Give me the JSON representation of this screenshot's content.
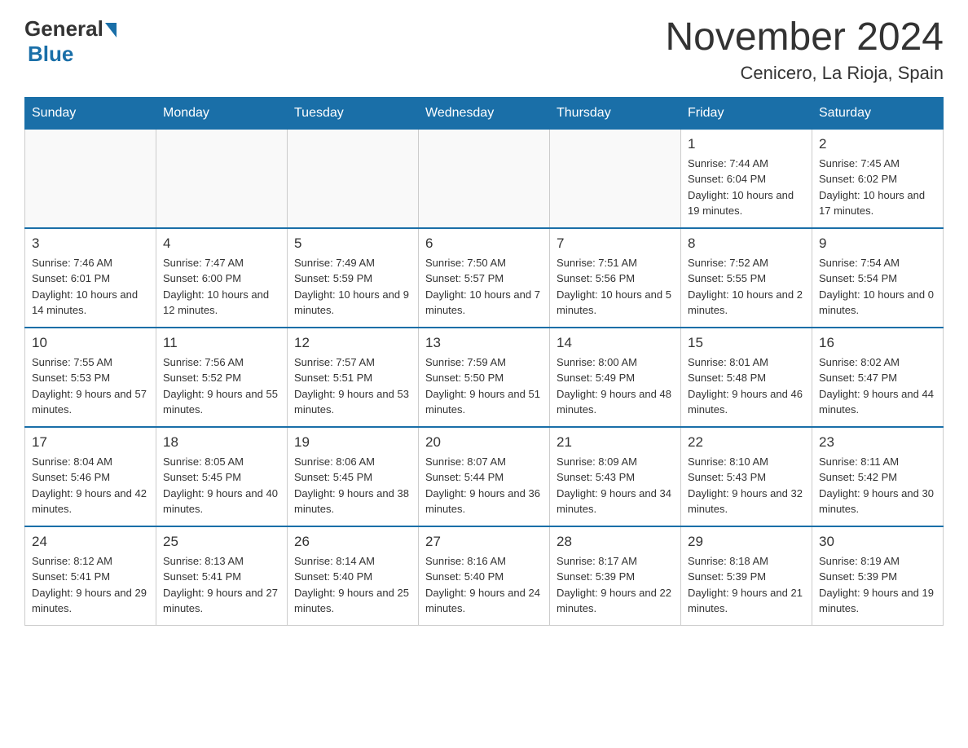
{
  "logo": {
    "general": "General",
    "blue": "Blue"
  },
  "header": {
    "month": "November 2024",
    "location": "Cenicero, La Rioja, Spain"
  },
  "weekdays": [
    "Sunday",
    "Monday",
    "Tuesday",
    "Wednesday",
    "Thursday",
    "Friday",
    "Saturday"
  ],
  "weeks": [
    [
      {
        "day": "",
        "sunrise": "",
        "sunset": "",
        "daylight": ""
      },
      {
        "day": "",
        "sunrise": "",
        "sunset": "",
        "daylight": ""
      },
      {
        "day": "",
        "sunrise": "",
        "sunset": "",
        "daylight": ""
      },
      {
        "day": "",
        "sunrise": "",
        "sunset": "",
        "daylight": ""
      },
      {
        "day": "",
        "sunrise": "",
        "sunset": "",
        "daylight": ""
      },
      {
        "day": "1",
        "sunrise": "Sunrise: 7:44 AM",
        "sunset": "Sunset: 6:04 PM",
        "daylight": "Daylight: 10 hours and 19 minutes."
      },
      {
        "day": "2",
        "sunrise": "Sunrise: 7:45 AM",
        "sunset": "Sunset: 6:02 PM",
        "daylight": "Daylight: 10 hours and 17 minutes."
      }
    ],
    [
      {
        "day": "3",
        "sunrise": "Sunrise: 7:46 AM",
        "sunset": "Sunset: 6:01 PM",
        "daylight": "Daylight: 10 hours and 14 minutes."
      },
      {
        "day": "4",
        "sunrise": "Sunrise: 7:47 AM",
        "sunset": "Sunset: 6:00 PM",
        "daylight": "Daylight: 10 hours and 12 minutes."
      },
      {
        "day": "5",
        "sunrise": "Sunrise: 7:49 AM",
        "sunset": "Sunset: 5:59 PM",
        "daylight": "Daylight: 10 hours and 9 minutes."
      },
      {
        "day": "6",
        "sunrise": "Sunrise: 7:50 AM",
        "sunset": "Sunset: 5:57 PM",
        "daylight": "Daylight: 10 hours and 7 minutes."
      },
      {
        "day": "7",
        "sunrise": "Sunrise: 7:51 AM",
        "sunset": "Sunset: 5:56 PM",
        "daylight": "Daylight: 10 hours and 5 minutes."
      },
      {
        "day": "8",
        "sunrise": "Sunrise: 7:52 AM",
        "sunset": "Sunset: 5:55 PM",
        "daylight": "Daylight: 10 hours and 2 minutes."
      },
      {
        "day": "9",
        "sunrise": "Sunrise: 7:54 AM",
        "sunset": "Sunset: 5:54 PM",
        "daylight": "Daylight: 10 hours and 0 minutes."
      }
    ],
    [
      {
        "day": "10",
        "sunrise": "Sunrise: 7:55 AM",
        "sunset": "Sunset: 5:53 PM",
        "daylight": "Daylight: 9 hours and 57 minutes."
      },
      {
        "day": "11",
        "sunrise": "Sunrise: 7:56 AM",
        "sunset": "Sunset: 5:52 PM",
        "daylight": "Daylight: 9 hours and 55 minutes."
      },
      {
        "day": "12",
        "sunrise": "Sunrise: 7:57 AM",
        "sunset": "Sunset: 5:51 PM",
        "daylight": "Daylight: 9 hours and 53 minutes."
      },
      {
        "day": "13",
        "sunrise": "Sunrise: 7:59 AM",
        "sunset": "Sunset: 5:50 PM",
        "daylight": "Daylight: 9 hours and 51 minutes."
      },
      {
        "day": "14",
        "sunrise": "Sunrise: 8:00 AM",
        "sunset": "Sunset: 5:49 PM",
        "daylight": "Daylight: 9 hours and 48 minutes."
      },
      {
        "day": "15",
        "sunrise": "Sunrise: 8:01 AM",
        "sunset": "Sunset: 5:48 PM",
        "daylight": "Daylight: 9 hours and 46 minutes."
      },
      {
        "day": "16",
        "sunrise": "Sunrise: 8:02 AM",
        "sunset": "Sunset: 5:47 PM",
        "daylight": "Daylight: 9 hours and 44 minutes."
      }
    ],
    [
      {
        "day": "17",
        "sunrise": "Sunrise: 8:04 AM",
        "sunset": "Sunset: 5:46 PM",
        "daylight": "Daylight: 9 hours and 42 minutes."
      },
      {
        "day": "18",
        "sunrise": "Sunrise: 8:05 AM",
        "sunset": "Sunset: 5:45 PM",
        "daylight": "Daylight: 9 hours and 40 minutes."
      },
      {
        "day": "19",
        "sunrise": "Sunrise: 8:06 AM",
        "sunset": "Sunset: 5:45 PM",
        "daylight": "Daylight: 9 hours and 38 minutes."
      },
      {
        "day": "20",
        "sunrise": "Sunrise: 8:07 AM",
        "sunset": "Sunset: 5:44 PM",
        "daylight": "Daylight: 9 hours and 36 minutes."
      },
      {
        "day": "21",
        "sunrise": "Sunrise: 8:09 AM",
        "sunset": "Sunset: 5:43 PM",
        "daylight": "Daylight: 9 hours and 34 minutes."
      },
      {
        "day": "22",
        "sunrise": "Sunrise: 8:10 AM",
        "sunset": "Sunset: 5:43 PM",
        "daylight": "Daylight: 9 hours and 32 minutes."
      },
      {
        "day": "23",
        "sunrise": "Sunrise: 8:11 AM",
        "sunset": "Sunset: 5:42 PM",
        "daylight": "Daylight: 9 hours and 30 minutes."
      }
    ],
    [
      {
        "day": "24",
        "sunrise": "Sunrise: 8:12 AM",
        "sunset": "Sunset: 5:41 PM",
        "daylight": "Daylight: 9 hours and 29 minutes."
      },
      {
        "day": "25",
        "sunrise": "Sunrise: 8:13 AM",
        "sunset": "Sunset: 5:41 PM",
        "daylight": "Daylight: 9 hours and 27 minutes."
      },
      {
        "day": "26",
        "sunrise": "Sunrise: 8:14 AM",
        "sunset": "Sunset: 5:40 PM",
        "daylight": "Daylight: 9 hours and 25 minutes."
      },
      {
        "day": "27",
        "sunrise": "Sunrise: 8:16 AM",
        "sunset": "Sunset: 5:40 PM",
        "daylight": "Daylight: 9 hours and 24 minutes."
      },
      {
        "day": "28",
        "sunrise": "Sunrise: 8:17 AM",
        "sunset": "Sunset: 5:39 PM",
        "daylight": "Daylight: 9 hours and 22 minutes."
      },
      {
        "day": "29",
        "sunrise": "Sunrise: 8:18 AM",
        "sunset": "Sunset: 5:39 PM",
        "daylight": "Daylight: 9 hours and 21 minutes."
      },
      {
        "day": "30",
        "sunrise": "Sunrise: 8:19 AM",
        "sunset": "Sunset: 5:39 PM",
        "daylight": "Daylight: 9 hours and 19 minutes."
      }
    ]
  ]
}
